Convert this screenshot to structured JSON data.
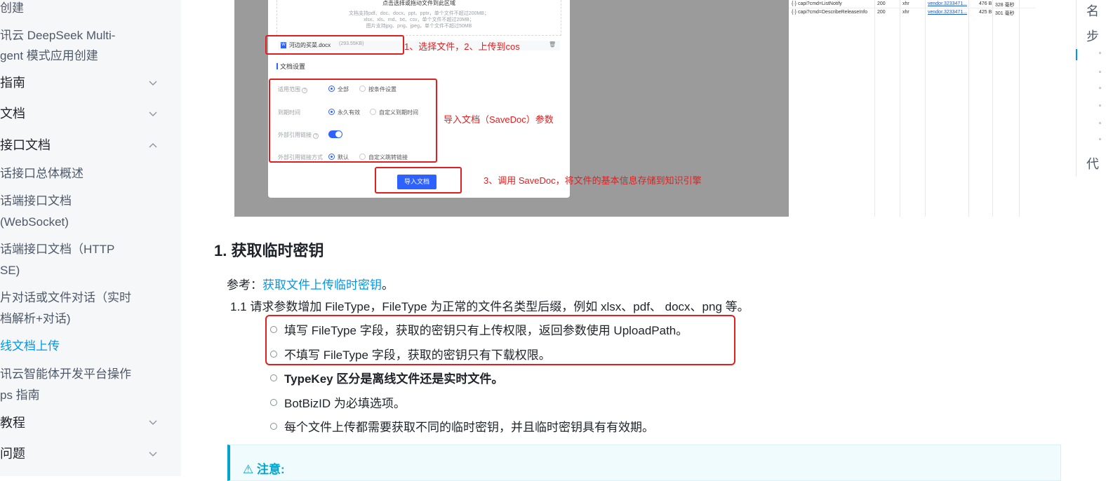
{
  "sidebar": {
    "items": [
      {
        "label": "创建",
        "type": "sub"
      },
      {
        "label": "讯云 DeepSeek Multi-",
        "type": "sub"
      },
      {
        "label": "gent 模式应用创建",
        "type": "sub"
      },
      {
        "label": "指南",
        "type": "section"
      },
      {
        "label": "文档",
        "type": "section"
      },
      {
        "label": "接口文档",
        "type": "section"
      },
      {
        "label": "话接口总体概述",
        "type": "sub"
      },
      {
        "label": "话端接口文档",
        "type": "sub"
      },
      {
        "label": "(WebSocket)",
        "type": "sub"
      },
      {
        "label": "话端接口文档（HTTP",
        "type": "sub"
      },
      {
        "label": "SE)",
        "type": "sub"
      },
      {
        "label": "片对话或文件对话（实时",
        "type": "sub"
      },
      {
        "label": "档解析+对话)",
        "type": "sub"
      },
      {
        "label": "线文档上传",
        "type": "active"
      },
      {
        "label": "讯云智能体开发平台操作",
        "type": "sub"
      },
      {
        "label": "ps 指南",
        "type": "sub"
      },
      {
        "label": "教程",
        "type": "section"
      },
      {
        "label": "问题",
        "type": "section"
      }
    ]
  },
  "screenshot": {
    "dropzone_title": "点击选择或拖动文件到此区域",
    "dropzone_hint1": "文档支持pdf、doc、docx、ppt、pptx，单个文件不超过200MB；",
    "dropzone_hint2": "xlsx、xls、md、txt、csv，单个文件不超过20MB；",
    "dropzone_hint3": "图片支持jpg、png、jpeg，单个文件不超过50MB",
    "file_name": "河边的买菜.docx",
    "file_size": "(293.55KB)",
    "section_title": "文档设置",
    "field1_label": "适用范围",
    "field1_opt1": "全部",
    "field1_opt2": "按条件设置",
    "field2_label": "到期时间",
    "field2_opt1": "永久有效",
    "field2_opt2": "自定义到期时间",
    "field3_label": "外部引用链接",
    "field4_label": "外部引用链接方式",
    "field4_opt1": "默认",
    "field4_opt2": "自定义跳转链接",
    "import_button": "导入文档",
    "annotation1": "1、选择文件，2、上传到cos",
    "annotation2": "导入文档（SaveDoc）参数",
    "annotation3": "3、调用 SaveDoc，将文件的基本信息存储到知识引擎",
    "network": [
      {
        "name": "capi?cmd=ListNotify",
        "status": "200",
        "type": "xhr",
        "initiator": "vendor.3233471...",
        "size": "476 B",
        "time": "328 毫秒"
      },
      {
        "name": "capi?cmd=DescribeReleaseInfo",
        "status": "200",
        "type": "xhr",
        "initiator": "vendor.3233471...",
        "size": "425 B",
        "time": "301 毫秒"
      }
    ]
  },
  "main": {
    "heading": "1. 获取临时密钥",
    "ref_prefix": "参考：",
    "ref_link": "获取文件上传临时密钥",
    "ref_suffix": "。",
    "item_1_1": "1.1  请求参数增加 FileType，FileType 为正常的文件名类型后缀，例如 xlsx、pdf、 docx、png 等。",
    "bullets": [
      "填写 FileType 字段，获取的密钥只有上传权限，返回参数使用 UploadPath。",
      "不填写 FileType 字段，获取的密钥只有下载权限。",
      "TypeKey 区分是离线文件还是实时文件。",
      "BotBizID 为必填选项。",
      "每个文件上传都需要获取不同的临时密钥，并且临时密钥具有有效期。"
    ],
    "note_title": "注意:"
  },
  "toc": {
    "items": [
      "名",
      "步",
      "代"
    ]
  },
  "colors": {
    "accent": "#0098ea",
    "annotation_red": "#e02020",
    "button_blue": "#2e62ff"
  }
}
